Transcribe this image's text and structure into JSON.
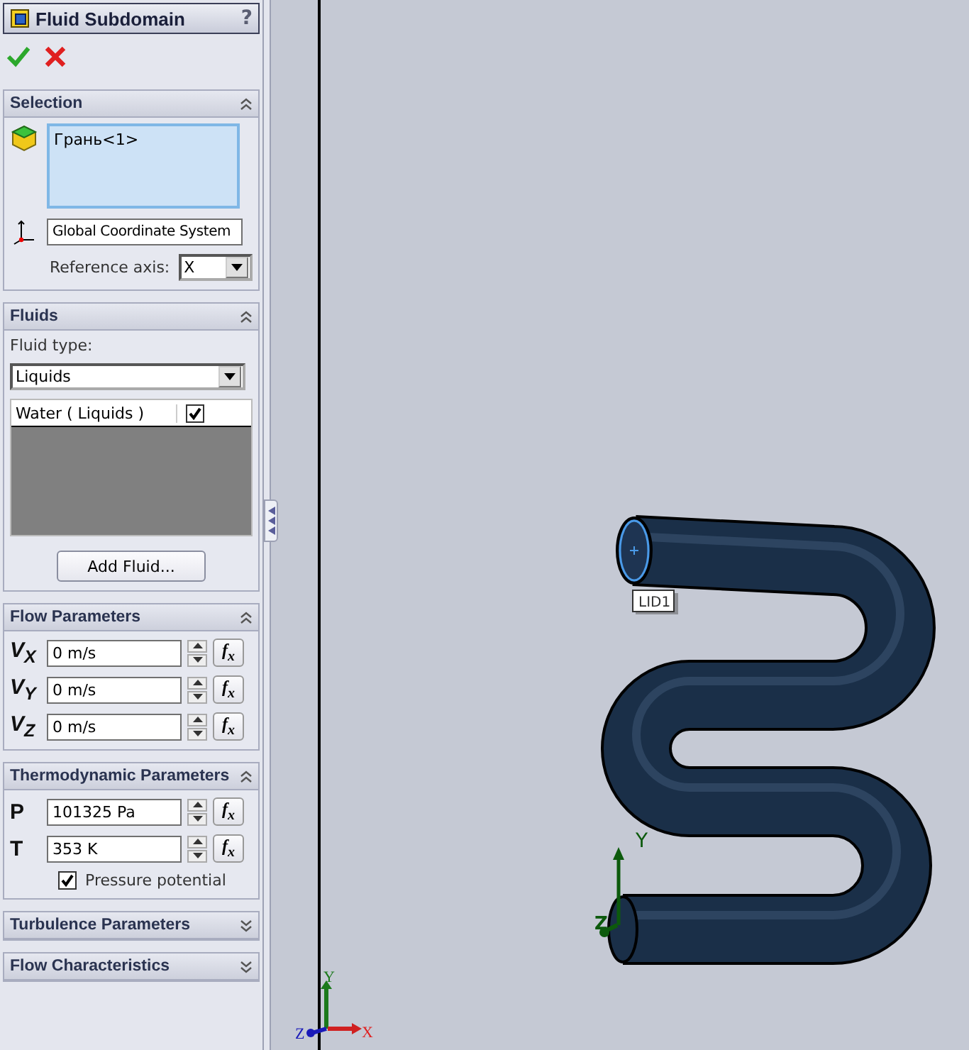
{
  "window": {
    "title": "Fluid Subdomain",
    "help": "?"
  },
  "sections": [
    {
      "kind": "selection",
      "title": "Selection",
      "expanded": true,
      "items": [
        "Грань<1>"
      ],
      "coordinate_system": "Global Coordinate System",
      "reference_axis": {
        "label": "Reference axis:",
        "value": "X"
      }
    },
    {
      "kind": "fluids",
      "title": "Fluids",
      "expanded": true,
      "fluid_type": {
        "label": "Fluid type:",
        "value": "Liquids"
      },
      "fluids": [
        {
          "name": "Water ( Liquids )",
          "checked": true
        }
      ],
      "button": "Add Fluid..."
    },
    {
      "kind": "parameters",
      "title": "Flow Parameters",
      "expanded": true,
      "params": [
        {
          "symbol": "V$_{X}$",
          "value": "0 m/s",
          "formula": "f$_{x}$"
        },
        {
          "symbol": "V$_{Y}$",
          "value": "0 m/s",
          "formula": "f$_{x}$"
        },
        {
          "symbol": "V$_{Z}$",
          "value": "0 m/s",
          "formula": "f$_{x}$"
        }
      ]
    },
    {
      "kind": "parameters",
      "title": "Thermodynamic Parameters",
      "expanded": true,
      "params": [
        {
          "symbol": "P",
          "value": "101325 Pa",
          "formula": "f$_{x}$"
        },
        {
          "symbol": "T",
          "value": "353 K",
          "formula": "f$_{x}$"
        }
      ],
      "options": [
        {
          "label": "Pressure potential",
          "checked": true
        }
      ]
    },
    {
      "title": "Turbulence Parameters",
      "expanded": false
    },
    {
      "title": "Flow Characteristics",
      "expanded": false
    }
  ],
  "viewport": {
    "tag": "LID1",
    "model_axes": [
      "Y",
      "Z"
    ],
    "view_axes": [
      "Y",
      "Z",
      "X"
    ]
  }
}
